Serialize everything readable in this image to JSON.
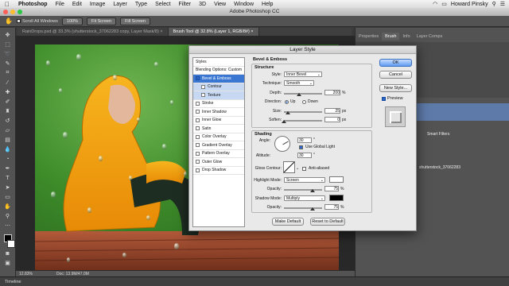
{
  "menubar": {
    "app": "Photoshop",
    "items": [
      "File",
      "Edit",
      "Image",
      "Layer",
      "Type",
      "Select",
      "Filter",
      "3D",
      "View",
      "Window",
      "Help"
    ],
    "user": "Howard Pinsky"
  },
  "window": {
    "title": "Adobe Photoshop CC"
  },
  "options_bar": {
    "scroll_all_label": "Scroll All Windows",
    "zoom_100_label": "100%",
    "fit_screen_label": "Fit Screen",
    "fill_screen_label": "Fill Screen"
  },
  "doc_tabs": [
    {
      "label": "RainDrops.psd @ 33.3% (shutterstock_37062283 copy, Layer Mask/8) ×",
      "active": false
    },
    {
      "label": "Brush Tool @ 32.8% (Layer 1, RGB/8#) ×",
      "active": true
    }
  ],
  "statusbar": {
    "zoom": "12.83%",
    "doc": "Doc: 13.9M/47.0M"
  },
  "timeline": {
    "label": "Timeline"
  },
  "right_panel": {
    "tabs": [
      "Properties",
      "Brush",
      "Info",
      "Layer Comps"
    ],
    "active_tab": "Brush",
    "smart_filters": "Smart Filters",
    "layer_name": "shutterstock_37062283"
  },
  "dialog": {
    "title": "Layer Style",
    "styles": [
      {
        "label": "Styles",
        "checkbox": false,
        "selected": false,
        "sub": false
      },
      {
        "label": "Blending Options: Custom",
        "checkbox": false,
        "selected": false,
        "sub": false
      },
      {
        "label": "Bevel & Emboss",
        "checkbox": true,
        "checked": true,
        "selected": true,
        "sub": false
      },
      {
        "label": "Contour",
        "checkbox": true,
        "checked": false,
        "selected": false,
        "sub": true
      },
      {
        "label": "Texture",
        "checkbox": true,
        "checked": false,
        "selected": false,
        "sub": true
      },
      {
        "label": "Stroke",
        "checkbox": true,
        "checked": false,
        "selected": false,
        "sub": false
      },
      {
        "label": "Inner Shadow",
        "checkbox": true,
        "checked": false,
        "selected": false,
        "sub": false
      },
      {
        "label": "Inner Glow",
        "checkbox": true,
        "checked": false,
        "selected": false,
        "sub": false
      },
      {
        "label": "Satin",
        "checkbox": true,
        "checked": false,
        "selected": false,
        "sub": false
      },
      {
        "label": "Color Overlay",
        "checkbox": true,
        "checked": false,
        "selected": false,
        "sub": false
      },
      {
        "label": "Gradient Overlay",
        "checkbox": true,
        "checked": false,
        "selected": false,
        "sub": false
      },
      {
        "label": "Pattern Overlay",
        "checkbox": true,
        "checked": false,
        "selected": false,
        "sub": false
      },
      {
        "label": "Outer Glow",
        "checkbox": true,
        "checked": false,
        "selected": false,
        "sub": false
      },
      {
        "label": "Drop Shadow",
        "checkbox": true,
        "checked": false,
        "selected": false,
        "sub": false
      }
    ],
    "bevel_section": "Bevel & Emboss",
    "structure_section": "Structure",
    "style_label": "Style:",
    "style_value": "Inner Bevel",
    "technique_label": "Technique:",
    "technique_value": "Smooth",
    "depth_label": "Depth:",
    "depth_value": "200",
    "depth_unit": "%",
    "direction_label": "Direction:",
    "direction_up": "Up",
    "direction_down": "Down",
    "size_label": "Size:",
    "size_value": "25",
    "size_unit": "px",
    "soften_label": "Soften:",
    "soften_value": "0",
    "soften_unit": "px",
    "shading_section": "Shading",
    "angle_label": "Angle:",
    "angle_value": "30",
    "angle_unit": "°",
    "global_light_label": "Use Global Light",
    "altitude_label": "Altitude:",
    "altitude_value": "30",
    "altitude_unit": "°",
    "gloss_label": "Gloss Contour:",
    "anti_aliased_label": "Anti-aliased",
    "highlight_label": "Highlight Mode:",
    "highlight_value": "Screen",
    "hl_opacity_label": "Opacity:",
    "hl_opacity_value": "75",
    "hl_opacity_unit": "%",
    "shadow_label": "Shadow Mode:",
    "shadow_value": "Multiply",
    "sh_opacity_label": "Opacity:",
    "sh_opacity_value": "75",
    "sh_opacity_unit": "%",
    "make_default": "Make Default",
    "reset_default": "Reset to Default",
    "ok": "OK",
    "cancel": "Cancel",
    "new_style": "New Style...",
    "preview": "Preview",
    "colors": {
      "highlight": "#ffffff",
      "shadow": "#000000"
    }
  }
}
